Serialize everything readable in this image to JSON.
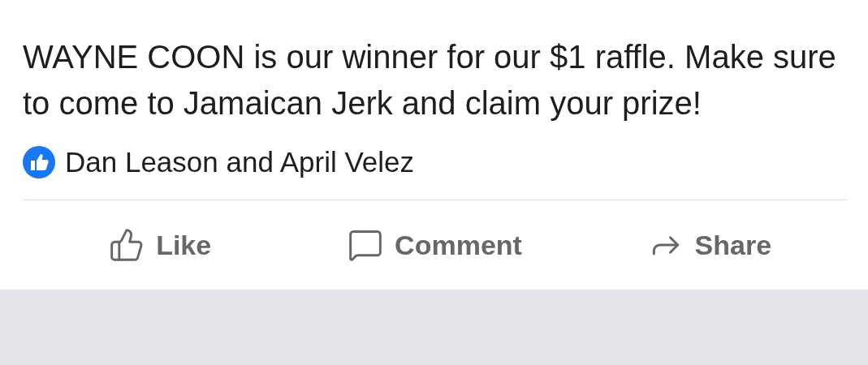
{
  "post": {
    "text": "WAYNE COON is our winner for our $1 raffle. Make sure to come to Jamaican Jerk and claim your prize!"
  },
  "reactions": {
    "names": "Dan Leason and April Velez"
  },
  "actions": [
    {
      "kind": "like",
      "label": "Like"
    },
    {
      "kind": "comment",
      "label": "Comment"
    },
    {
      "kind": "share",
      "label": "Share"
    }
  ]
}
